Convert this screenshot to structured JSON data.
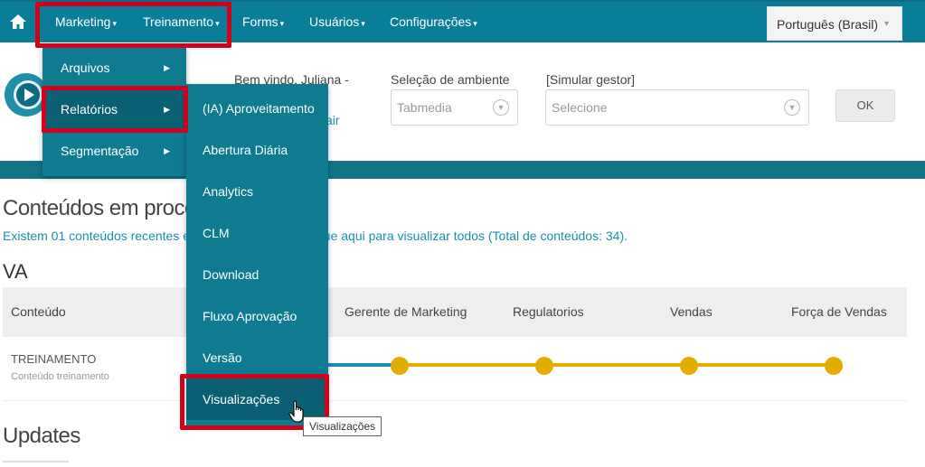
{
  "navbar": {
    "home_icon": "home-icon",
    "items": [
      {
        "label": "Marketing",
        "caret": "▾"
      },
      {
        "label": "Treinamento",
        "caret": "▾"
      },
      {
        "label": "Forms",
        "caret": "▾"
      },
      {
        "label": "Usuários",
        "caret": "▾"
      },
      {
        "label": "Configurações",
        "caret": "▾"
      }
    ],
    "language": {
      "value": "Português (Brasil)",
      "caret": "▾"
    }
  },
  "header": {
    "welcome": "Bem vindo, Juliana -",
    "logout_link": "air",
    "environment": {
      "label": "Seleção de ambiente",
      "value": "Tabmedia"
    },
    "manager": {
      "label": "[Simular gestor]",
      "placeholder": "Selecione"
    },
    "ok_label": "OK"
  },
  "content": {
    "section_title": "Conteúdos em process",
    "info_left": "Existem 01 conteúdos recentes em",
    "info_right": "que aqui para visualizar todos (Total de conteúdos: 34).",
    "va_title": "VA",
    "table": {
      "headers": [
        "Conteúdo",
        "Gerente de Marketing",
        "Regulatorios",
        "Vendas",
        "Força de Vendas"
      ],
      "rows": [
        {
          "title": "TREINAMENTO",
          "subtitle": "Conteúdo treinamento"
        }
      ]
    },
    "updates_title": "Updates"
  },
  "menus": {
    "level1": [
      {
        "label": "Arquivos",
        "arrow": "▶"
      },
      {
        "label": "Relatórios",
        "arrow": "▶"
      },
      {
        "label": "Segmentação",
        "arrow": "▶"
      }
    ],
    "level2": [
      {
        "label": "(IA) Aproveitamento"
      },
      {
        "label": "Abertura Diária"
      },
      {
        "label": "Analytics"
      },
      {
        "label": "CLM"
      },
      {
        "label": "Download"
      },
      {
        "label": "Fluxo Aprovação"
      },
      {
        "label": "Versão"
      },
      {
        "label": "Visualizações"
      }
    ]
  },
  "tooltip": "Visualizações",
  "colors": {
    "navbar": "#0a7e98",
    "menu": "#0f7b91",
    "highlight": "#d0021b",
    "progress_done": "#1a8fb0",
    "progress_pending": "#e4ac00"
  }
}
